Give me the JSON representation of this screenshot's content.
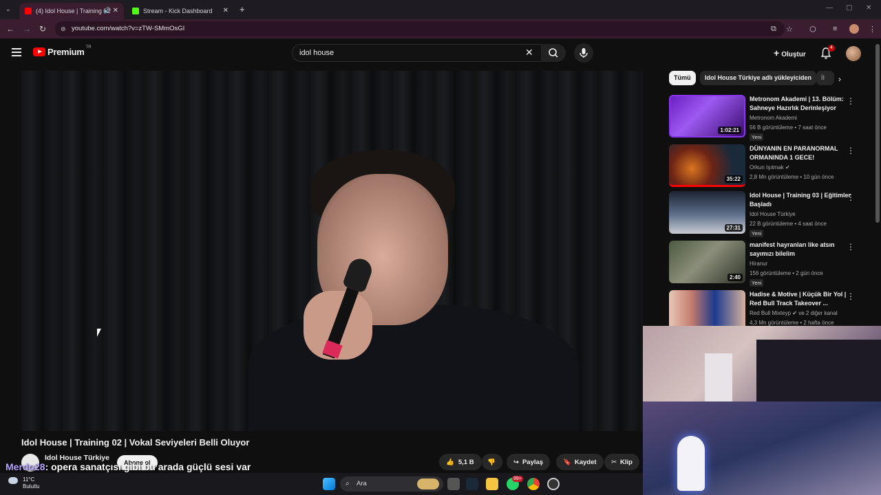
{
  "browser": {
    "tabs": [
      {
        "title": "(4) Idol House | Training 02",
        "active": true
      },
      {
        "title": "Stream - Kick Dashboard",
        "active": false
      }
    ],
    "url": "youtube.com/watch?v=zTW-SMmOsGI"
  },
  "header": {
    "logo_text": "Premium",
    "region": "TR",
    "search_value": "idol house",
    "create_label": "Oluştur",
    "notification_count": "4"
  },
  "video": {
    "title": "Idol House | Training 02 | Vokal Seviyeleri Belli Oluyor",
    "channel": "Idol House Türkiye",
    "subscribe_label": "Abone ol",
    "likes": "5,1 B",
    "share_label": "Paylaş",
    "save_label": "Kaydet",
    "clip_label": "Klip"
  },
  "caption": {
    "name": "Merdo28",
    "text": ": opera sanatçısı gibi bu arada güçlü sesi var"
  },
  "chips": [
    "Tümü",
    "Idol House Türkiye adlı yükleyiciden",
    "İl"
  ],
  "recommendations": [
    {
      "title": "Metronom Akademi | 13. Bölüm: Sahneye Hazırlık Derinleşiyor",
      "channel": "Metronom Akademi",
      "meta": "56 B görüntüleme • 7 saat önce",
      "badge": "Yeni",
      "duration": "1:02:21"
    },
    {
      "title": "DÜNYANIN EN PARANORMAL ORMANINDA 1 GECE!",
      "channel": "Orkun Işıtmak",
      "meta": "2,8 Mn görüntüleme • 10 gün önce",
      "badge": "",
      "duration": "35:22"
    },
    {
      "title": "Idol House | Training 03 | Eğitimler Başladı",
      "channel": "Idol House Türkiye",
      "meta": "22 B görüntüleme • 4 saat önce",
      "badge": "Yeni",
      "duration": "27:31"
    },
    {
      "title": "manifest hayranları like atsın sayımızı bilelim",
      "channel": "Hiranur",
      "meta": "156 görüntüleme • 2 gün önce",
      "badge": "Yeni",
      "duration": "2:40"
    },
    {
      "title": "Hadise & Motive | Küçük Bir Yol | Red Bull Track Takeover ...",
      "channel": "Red Bull Mixteyp",
      "channel_extra": "ve 2 diğer kanal",
      "meta": "4,3 Mn görüntüleme • 2 hafta önce",
      "badge": "",
      "duration": ""
    }
  ],
  "taskbar": {
    "temp": "11°C",
    "weather": "Bulutlu",
    "search_placeholder": "Ara",
    "whatsapp_badge": "99+"
  },
  "colors": {
    "accent_red": "#ff0000",
    "tab_active": "#3a1d2e",
    "chat_name": "#b7a2ff"
  }
}
